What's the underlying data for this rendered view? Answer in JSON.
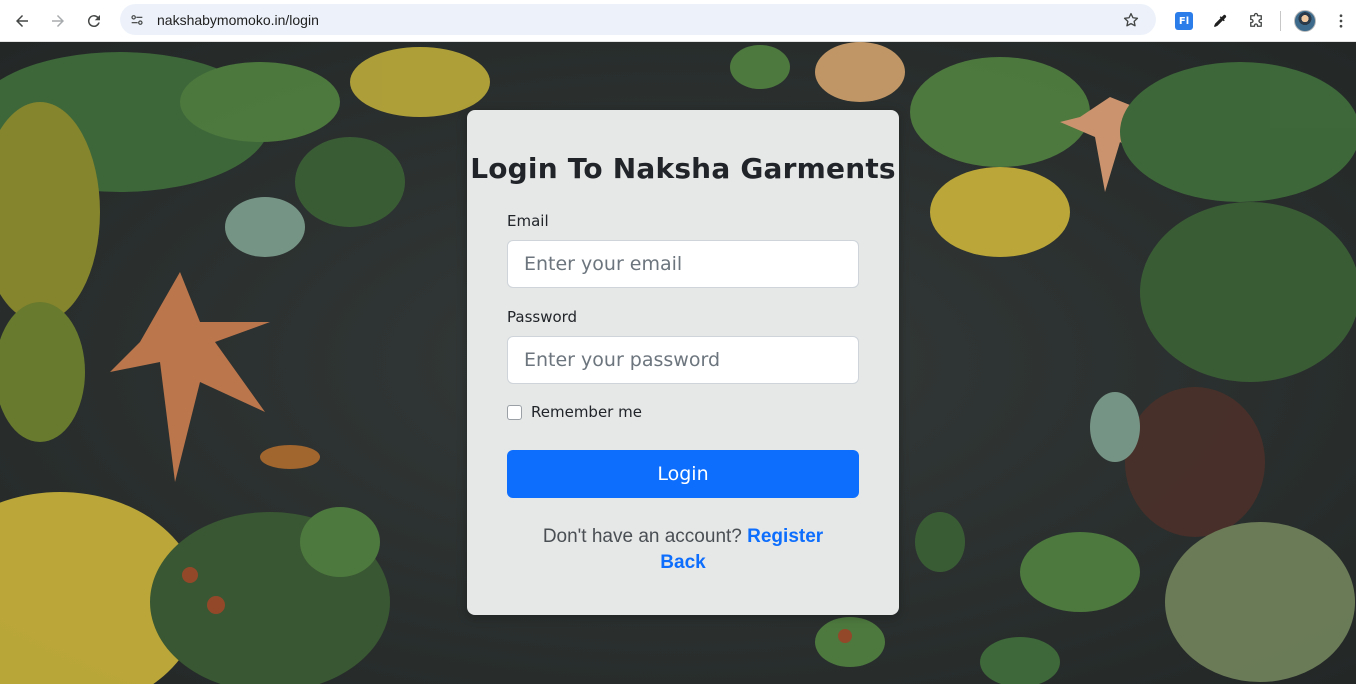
{
  "browser": {
    "url": "nakshabymomoko.in/login",
    "icons": [
      "back-arrow-icon",
      "forward-arrow-icon",
      "reload-icon",
      "site-settings-icon",
      "star-icon",
      "extension-fl-icon",
      "eyedropper-icon",
      "puzzle-icon",
      "profile-avatar",
      "kebab-menu-icon"
    ],
    "extension_badge": "Fl"
  },
  "login": {
    "title": "Login To Naksha Garments",
    "email_label": "Email",
    "email_placeholder": "Enter your email",
    "email_value": "",
    "password_label": "Password",
    "password_placeholder": "Enter your password",
    "password_value": "",
    "remember_label": "Remember me",
    "remember_checked": false,
    "login_button": "Login",
    "no_account_text": "Don't have an account?",
    "register_link": "Register",
    "back_link": "Back"
  },
  "colors": {
    "primary": "#0d6efd",
    "card_bg": "#ecedec",
    "page_bg": "#2b302f"
  }
}
